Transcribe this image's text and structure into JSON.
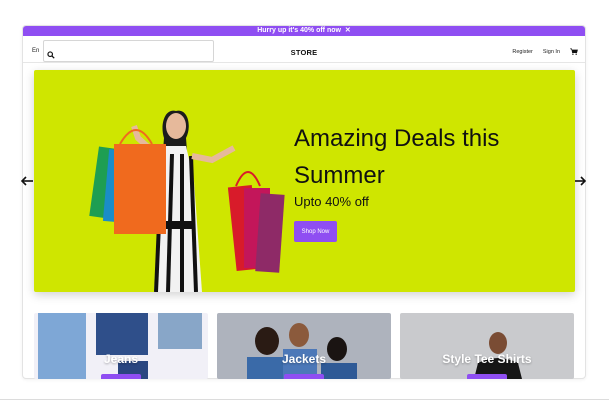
{
  "promo": {
    "text": "Hurry up it's 40% off now",
    "close": "✕"
  },
  "header": {
    "language": "En",
    "search_placeholder": "",
    "brand": "STORE",
    "register": "Register",
    "sign_in": "Sign In",
    "cart_icon": "cart-icon"
  },
  "hero": {
    "title": "Amazing Deals this Summer",
    "subtitle": "Upto 40% off",
    "cta": "Shop Now",
    "background": "#cfe600"
  },
  "carousel": {
    "prev_icon": "arrow-left-icon",
    "next_icon": "arrow-right-icon"
  },
  "categories": [
    {
      "label": "Jeans"
    },
    {
      "label": "Jackets"
    },
    {
      "label": "Style Tee Shirts"
    }
  ],
  "colors": {
    "accent": "#8f4ef2",
    "hero_bg": "#cfe600"
  }
}
